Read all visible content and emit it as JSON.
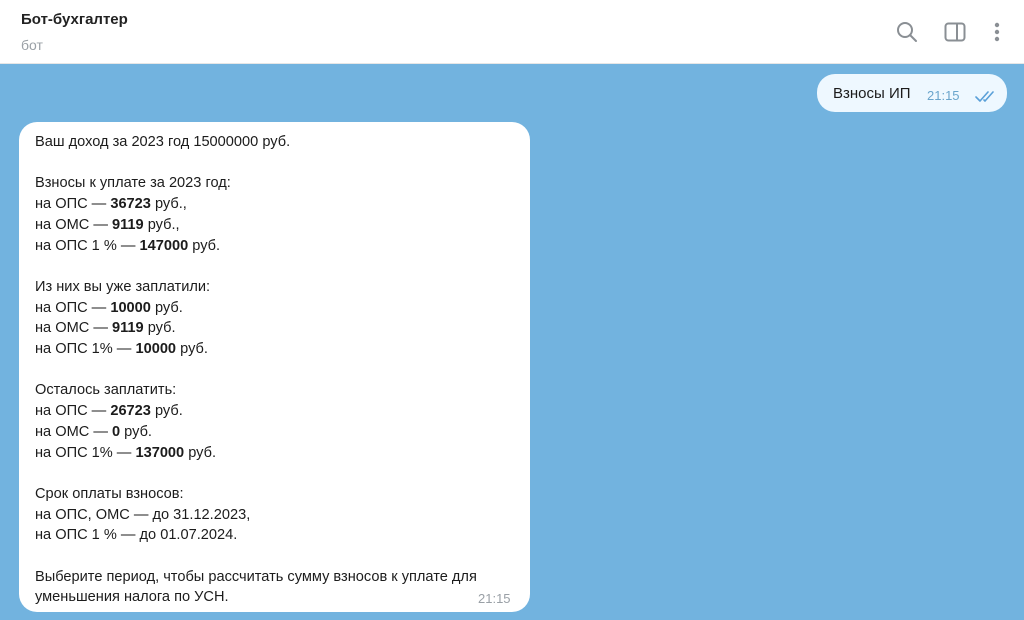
{
  "header": {
    "title": "Бот-бухгалтер",
    "subtitle": "бот",
    "icons": [
      "search-icon",
      "sidebar-panel-icon",
      "more-vertical-icon"
    ]
  },
  "colors": {
    "chat_background": "#72b3df",
    "outgoing_bubble": "#eef8ff",
    "incoming_bubble": "#ffffff",
    "read_checks": "#5aa0d8"
  },
  "outgoing_message": {
    "text": "Взносы ИП",
    "time": "21:15",
    "status_icon": "double-check-icon"
  },
  "incoming_message": {
    "time": "21:15",
    "income_line": "Ваш доход за 2023 год 15000000 руб.",
    "due_heading": "Взносы к уплате за 2023 год:",
    "due": [
      {
        "label": "на ОПС — ",
        "amount": "36723",
        "unit": " руб.,"
      },
      {
        "label": "на ОМС — ",
        "amount": "9119",
        "unit": " руб.,"
      },
      {
        "label": "на ОПС 1 % — ",
        "amount": "147000",
        "unit": " руб."
      }
    ],
    "paid_heading": "Из них вы уже заплатили:",
    "paid": [
      {
        "label": "на ОПС — ",
        "amount": "10000",
        "unit": " руб."
      },
      {
        "label": "на ОМС — ",
        "amount": "9119",
        "unit": " руб."
      },
      {
        "label": "на ОПС 1% — ",
        "amount": "10000",
        "unit": " руб."
      }
    ],
    "remaining_heading": "Осталось заплатить:",
    "remaining": [
      {
        "label": "на ОПС — ",
        "amount": "26723",
        "unit": " руб."
      },
      {
        "label": "на ОМС — ",
        "amount": "0",
        "unit": " руб."
      },
      {
        "label": "на ОПС 1% — ",
        "amount": "137000",
        "unit": " руб."
      }
    ],
    "deadline_heading": "Срок оплаты взносов:",
    "deadlines": [
      "на ОПС, ОМС — до 31.12.2023,",
      "на ОПС 1 % — до 01.07.2024."
    ],
    "closing": "Выберите период, чтобы рассчитать сумму взносов к уплате для уменьшения налога по УСН."
  }
}
